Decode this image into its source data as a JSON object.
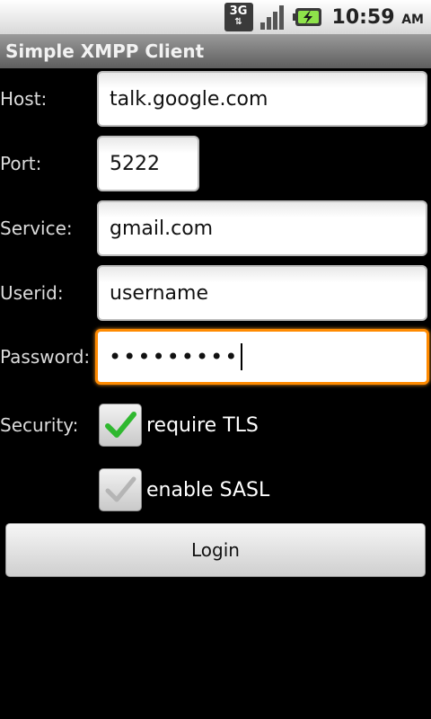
{
  "status_bar": {
    "network_label": "3G",
    "time": "10:59",
    "ampm": "AM",
    "icons": [
      "3g-data-icon",
      "signal-icon",
      "battery-charging-icon"
    ]
  },
  "title": "Simple XMPP Client",
  "form": {
    "host": {
      "label": "Host:",
      "value": "talk.google.com"
    },
    "port": {
      "label": "Port:",
      "value": "5222"
    },
    "service": {
      "label": "Service:",
      "value": "gmail.com"
    },
    "userid": {
      "label": "Userid:",
      "value": "username"
    },
    "password": {
      "label": "Password:",
      "value": "•••••••••"
    },
    "security": {
      "label": "Security:"
    }
  },
  "checkboxes": {
    "require_tls": {
      "label": "require TLS",
      "checked": true
    },
    "enable_sasl": {
      "label": "enable SASL",
      "checked": false
    }
  },
  "login_button": {
    "label": "Login"
  },
  "colors": {
    "focus": "#ff8a00",
    "check_green": "#2fb82f"
  }
}
